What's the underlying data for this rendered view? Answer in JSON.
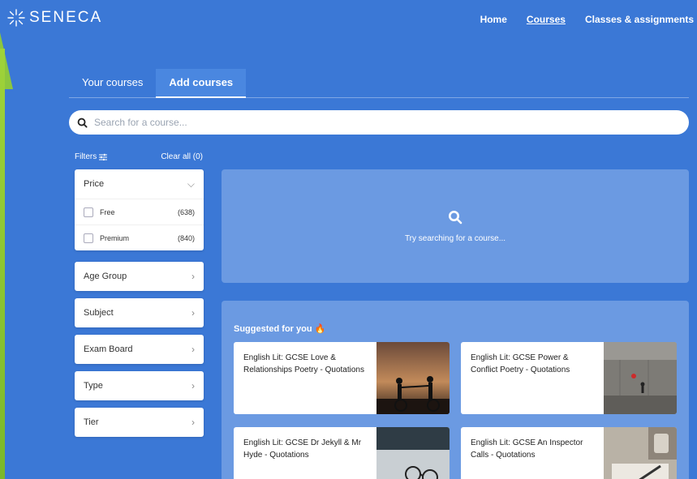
{
  "brand": {
    "name": "SENECA"
  },
  "nav": {
    "home": "Home",
    "courses": "Courses",
    "classes": "Classes & assignments"
  },
  "tabs": {
    "your_courses": "Your courses",
    "add_courses": "Add courses"
  },
  "search": {
    "placeholder": "Search for a course..."
  },
  "filters": {
    "label": "Filters",
    "clear": "Clear all (0)",
    "price": {
      "title": "Price",
      "options": [
        {
          "label": "Free",
          "count": "(638)"
        },
        {
          "label": "Premium",
          "count": "(840)"
        }
      ]
    },
    "age_group": "Age Group",
    "subject": "Subject",
    "exam_board": "Exam Board",
    "type": "Type",
    "tier": "Tier"
  },
  "empty_state": {
    "text": "Try searching for a course..."
  },
  "suggested": {
    "title": "Suggested for you 🔥",
    "cards": [
      {
        "title": "English Lit: GCSE Love & Relationships Poetry - Quotations"
      },
      {
        "title": "English Lit: GCSE Power & Conflict Poetry - Quotations"
      },
      {
        "title": "English Lit: GCSE Dr Jekyll & Mr Hyde - Quotations"
      },
      {
        "title": "English Lit: GCSE An Inspector Calls - Quotations"
      }
    ]
  },
  "colors": {
    "background": "#3b78d6",
    "panel": "#6b9ae2",
    "accent_green": "#8cc63f"
  }
}
